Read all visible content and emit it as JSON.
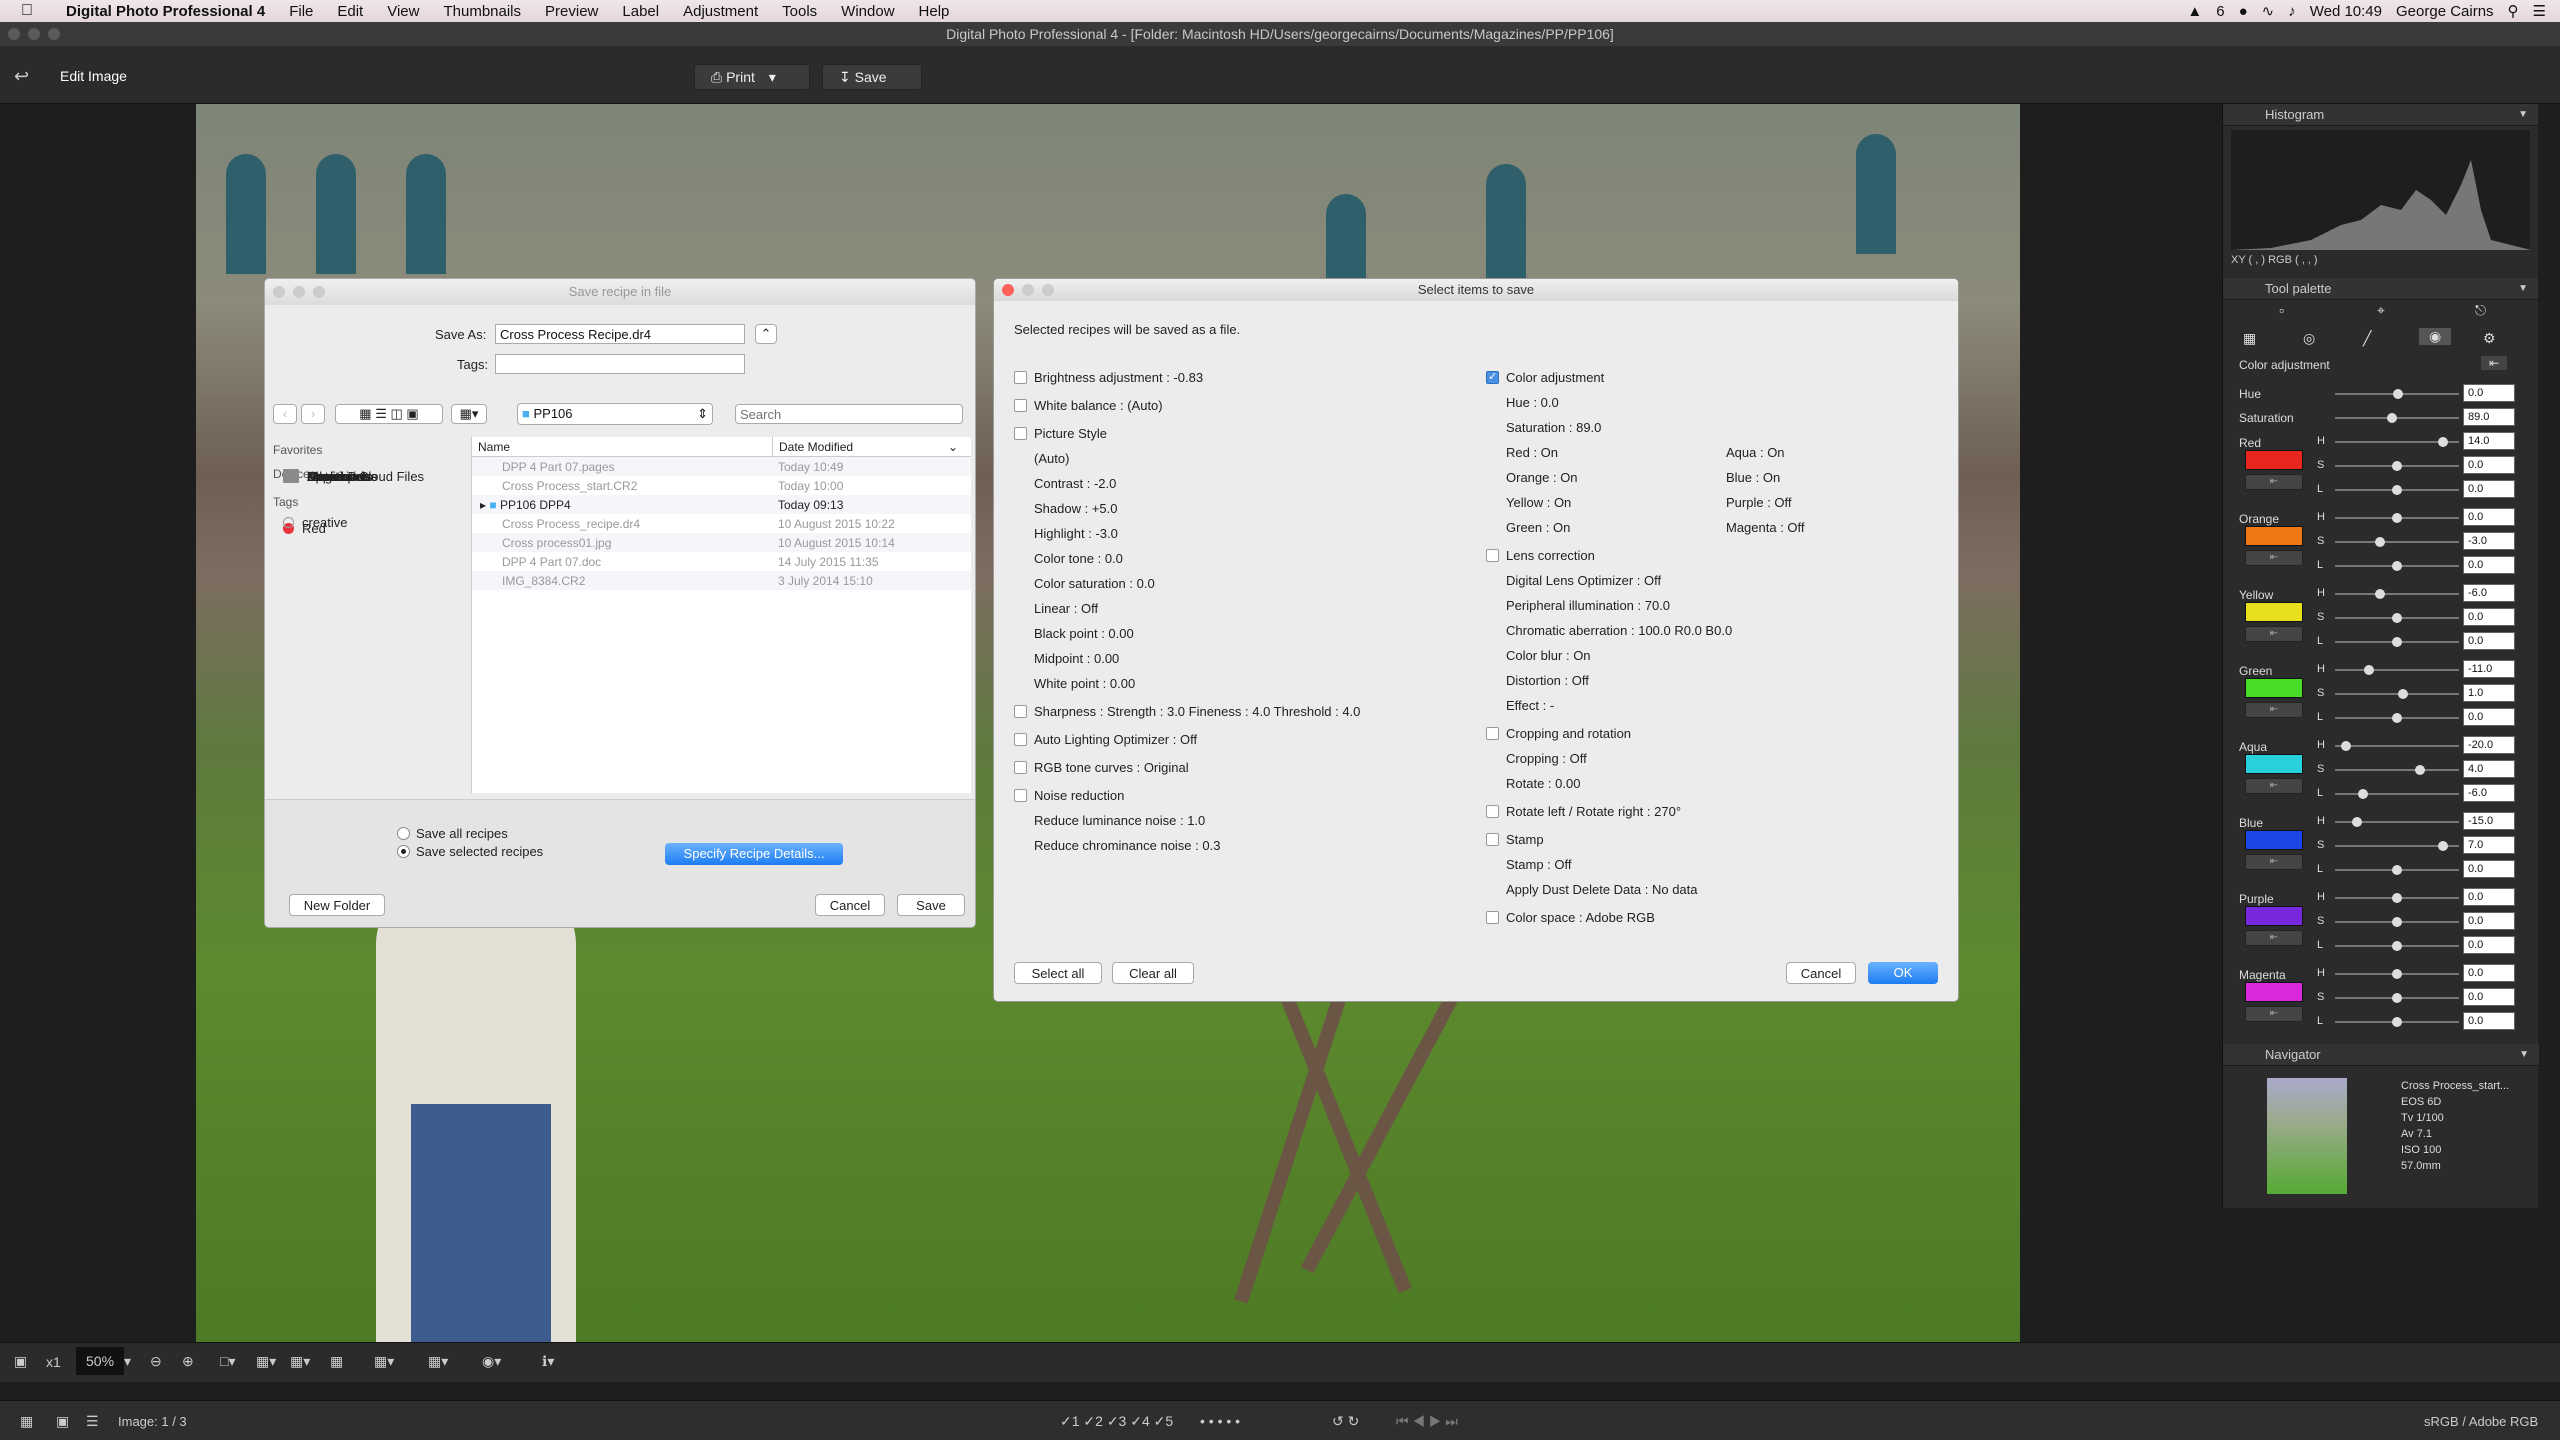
{
  "menubar": {
    "app": "Digital Photo Professional 4",
    "items": [
      "File",
      "Edit",
      "View",
      "Thumbnails",
      "Preview",
      "Label",
      "Adjustment",
      "Tools",
      "Window",
      "Help"
    ],
    "battery": "6",
    "clock": "Wed 10:49",
    "user": "George Cairns"
  },
  "window": {
    "title": "Digital Photo Professional 4 - [Folder: Macintosh HD/Users/georgecairns/Documents/Magazines/PP/PP106]"
  },
  "toolbar": {
    "edit_label": "Edit Image",
    "print_label": "Print",
    "save_label": "Save"
  },
  "saveDialog": {
    "title": "Save recipe in file",
    "saveAsLabel": "Save As:",
    "saveAsValue": "Cross Process Recipe.dr4",
    "tagsLabel": "Tags:",
    "folder": "PP106",
    "search_placeholder": "Search",
    "favoritesHeader": "Favorites",
    "favorites": [
      "iCloud Drive",
      "Applications",
      "Desktop",
      "Documents",
      "Magazines",
      "Downloads",
      "Pictures",
      "Movies",
      "Creative Cloud Files"
    ],
    "devicesHeader": "Devices",
    "tagsHeader": "Tags",
    "tags": [
      "Red",
      "creative"
    ],
    "colName": "Name",
    "colDate": "Date Modified",
    "files": [
      {
        "name": "DPP 4 Part 07.pages",
        "date": "Today 10:49"
      },
      {
        "name": "Cross Process_start.CR2",
        "date": "Today 10:00"
      },
      {
        "name": "PP106 DPP4",
        "date": "Today 09:13"
      },
      {
        "name": "Cross Process_recipe.dr4",
        "date": "10 August 2015 10:22"
      },
      {
        "name": "Cross process01.jpg",
        "date": "10 August 2015 10:14"
      },
      {
        "name": "DPP 4 Part 07.doc",
        "date": "14 July 2015 11:35"
      },
      {
        "name": "IMG_8384.CR2",
        "date": "3 July 2014 15:10"
      }
    ],
    "radioAll": "Save all recipes",
    "radioSelected": "Save selected recipes",
    "specifyBtn": "Specify Recipe Details...",
    "newFolder": "New Folder",
    "cancel": "Cancel",
    "save": "Save"
  },
  "itemsDialog": {
    "title": "Select items to save",
    "intro": "Selected recipes will be saved as a file.",
    "left": {
      "brightness": "Brightness adjustment : -0.83",
      "wb": "White balance : (Auto)",
      "ps": "Picture Style",
      "ps_auto": "(Auto)",
      "contrast": "Contrast : -2.0",
      "shadow": "Shadow : +5.0",
      "highlight": "Highlight : -3.0",
      "colortone": "Color tone : 0.0",
      "colorsat": "Color saturation : 0.0",
      "linear": "Linear : Off",
      "black": "Black point : 0.00",
      "mid": "Midpoint : 0.00",
      "white": "White point : 0.00",
      "sharp": "Sharpness : Strength : 3.0 Fineness : 4.0 Threshold : 4.0",
      "alo": "Auto Lighting Optimizer : Off",
      "rgb": "RGB tone curves : Original",
      "noise": "Noise reduction",
      "lum": "Reduce luminance noise : 1.0",
      "chrom": "Reduce chrominance noise : 0.3"
    },
    "right": {
      "ca": "Color adjustment",
      "hue": "Hue : 0.0",
      "sat": "Saturation : 89.0",
      "red": "Red : On",
      "orange": "Orange : On",
      "yellow": "Yellow : On",
      "green": "Green : On",
      "aqua": "Aqua : On",
      "blue": "Blue : On",
      "purple": "Purple : Off",
      "magenta": "Magenta : Off",
      "lens": "Lens correction",
      "dlo": "Digital Lens Optimizer : Off",
      "peri": "Peripheral illumination : 70.0",
      "chroma": "Chromatic aberration : 100.0 R0.0 B0.0",
      "blur": "Color blur : On",
      "dist": "Distortion : Off",
      "effect": "Effect : -",
      "crop": "Cropping and rotation",
      "cropping": "Cropping : Off",
      "rotate": "Rotate : 0.00",
      "rotlr": "Rotate left / Rotate right : 270°",
      "stamp": "Stamp",
      "stampv": "Stamp : Off",
      "dust": "Apply Dust Delete Data : No data",
      "space": "Color space : Adobe RGB"
    },
    "selectAll": "Select all",
    "clearAll": "Clear all",
    "cancel": "Cancel",
    "ok": "OK"
  },
  "panel": {
    "histogram": "Histogram",
    "xy": "XY (         ,         )  RGB (         ,         ,         )",
    "toolPalette": "Tool palette",
    "colorAdj": "Color adjustment",
    "hueLabel": "Hue",
    "hueVal": "0.0",
    "satLabel": "Saturation",
    "satVal": "89.0",
    "groups": [
      {
        "name": "Red",
        "color": "#e8281e",
        "h": "14.0",
        "s": "0.0",
        "l": "0.0",
        "hp": 0.9,
        "sp": 0.5,
        "lp": 0.5
      },
      {
        "name": "Orange",
        "color": "#f07814",
        "h": "0.0",
        "s": "-3.0",
        "l": "0.0",
        "hp": 0.5,
        "sp": 0.35,
        "lp": 0.5
      },
      {
        "name": "Yellow",
        "color": "#e8e01e",
        "h": "-6.0",
        "s": "0.0",
        "l": "0.0",
        "hp": 0.35,
        "sp": 0.5,
        "lp": 0.5
      },
      {
        "name": "Green",
        "color": "#46dc28",
        "h": "-11.0",
        "s": "1.0",
        "l": "0.0",
        "hp": 0.25,
        "sp": 0.55,
        "lp": 0.5
      },
      {
        "name": "Aqua",
        "color": "#28d2dc",
        "h": "-20.0",
        "s": "4.0",
        "l": "-6.0",
        "hp": 0.05,
        "sp": 0.7,
        "lp": 0.2
      },
      {
        "name": "Blue",
        "color": "#1e46e6",
        "h": "-15.0",
        "s": "7.0",
        "l": "0.0",
        "hp": 0.15,
        "sp": 0.9,
        "lp": 0.5
      },
      {
        "name": "Purple",
        "color": "#7828dc",
        "h": "0.0",
        "s": "0.0",
        "l": "0.0",
        "hp": 0.5,
        "sp": 0.5,
        "lp": 0.5
      },
      {
        "name": "Magenta",
        "color": "#dc28dc",
        "h": "0.0",
        "s": "0.0",
        "l": "0.0",
        "hp": 0.5,
        "sp": 0.5,
        "lp": 0.5
      }
    ],
    "navigator": "Navigator",
    "info": [
      "Cross Process_start...",
      "EOS 6D",
      "Tv 1/100",
      "Av 7.1",
      "ISO 100",
      "57.0mm"
    ]
  },
  "bottom": {
    "zoom1": "x1",
    "zoom": "50%",
    "image": "Image: 1 / 3",
    "colorspace": "sRGB / Adobe RGB"
  }
}
